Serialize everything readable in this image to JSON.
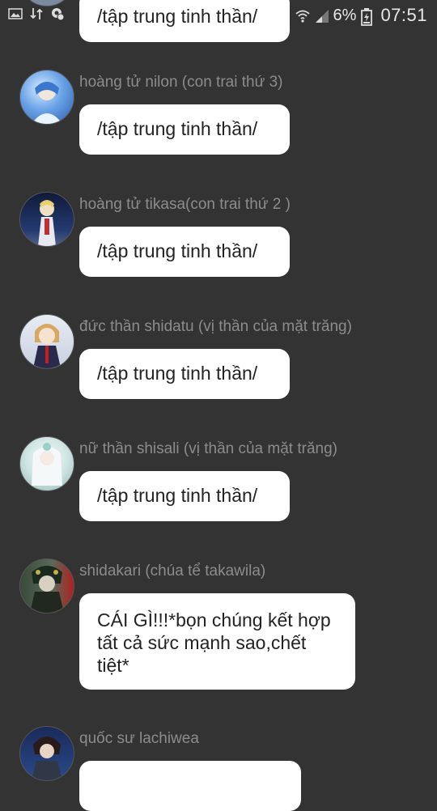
{
  "status_bar": {
    "battery_percent": "6%",
    "time": "07:51",
    "icons": [
      "image-icon",
      "data-transfer-icon",
      "settings-sync-icon",
      "wifi-icon",
      "signal-icon",
      "battery-icon"
    ]
  },
  "messages": [
    {
      "name": "",
      "text": "/tập trung tinh thần/"
    },
    {
      "name": "hoàng tử nilon  (con trai thứ 3)",
      "text": "/tập trung tinh thần/",
      "avatar_color": "#5a8fd8"
    },
    {
      "name": "hoàng tử tikasa(con trai thứ 2 )",
      "text": "/tập trung tinh thần/",
      "avatar_color": "#1c2c55"
    },
    {
      "name": "đức thần shidatu (vị thần của mặt trăng)",
      "text": "/tập trung tinh thần/",
      "avatar_color": "#c9a56a"
    },
    {
      "name": "nữ thần shisali (vị thần của mặt trăng)",
      "text": "/tập trung tinh thần/",
      "avatar_color": "#cfe3e0"
    },
    {
      "name": "shidakari (chúa tể takawila)",
      "text": "CÁI GÌ!!!*bọn chúng kết hợp tất cả sức mạnh sao,chết tiệt*",
      "avatar_color": "#4a5a45"
    },
    {
      "name": "quốc sư lachiwea",
      "text": "",
      "avatar_color": "#243a6a"
    }
  ]
}
